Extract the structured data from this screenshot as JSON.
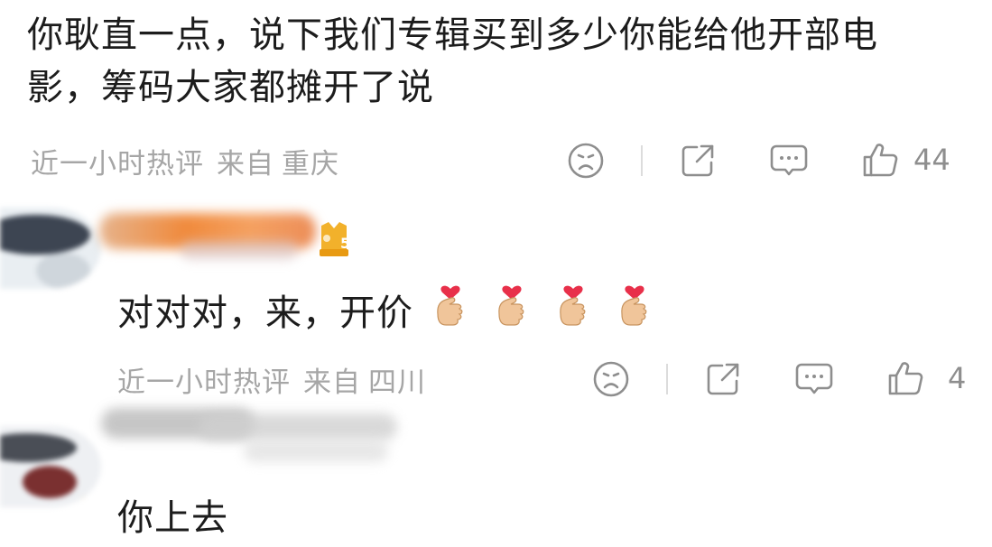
{
  "main_comment": {
    "text_line1": "你耿直一点，说下我们专辑买到多少你能给他开部电",
    "text_line2": "影，筹码大家都摊开了说",
    "time": "近一小时热评",
    "from_label": "来自",
    "location": "重庆",
    "likes": "44"
  },
  "reply1": {
    "level": "5",
    "text": "对对对，来，开价",
    "emojis": [
      "finger-heart",
      "finger-heart",
      "finger-heart",
      "finger-heart"
    ],
    "time": "近一小时热评",
    "from_label": "来自",
    "location": "四川",
    "likes": "4"
  },
  "reply2": {
    "text": "你上去"
  },
  "icons": {
    "dislike": "sad-face-icon",
    "share": "share-icon",
    "comment": "comment-icon",
    "like": "thumbs-up-icon"
  },
  "colors": {
    "meta_text": "#a6a6a6",
    "icon_gray": "#8e8e8e",
    "body_text": "#1c1c1c",
    "badge_gold": "#f2b12b",
    "heart_red": "#e8304a"
  }
}
